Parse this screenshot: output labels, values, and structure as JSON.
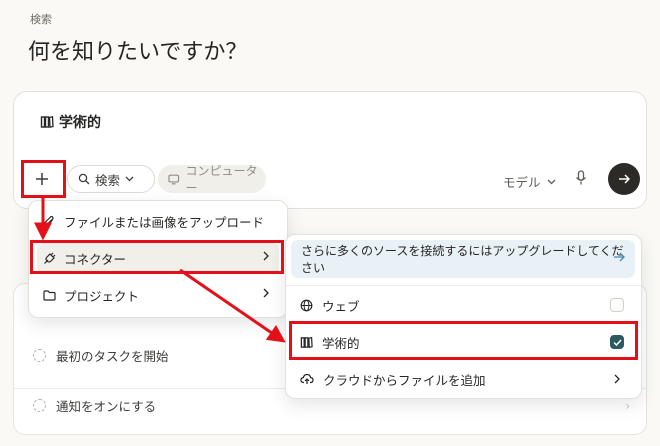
{
  "header": {
    "eyebrow": "検索",
    "title": "何を知りたいですか？"
  },
  "composer": {
    "mode_label": "学術的",
    "search_label": "検索",
    "computer_label": "コンピューター",
    "model_label": "モデル"
  },
  "tasks": [
    {
      "label": "最初のタスクを開始"
    },
    {
      "label": "通知をオンにする"
    }
  ],
  "attach_menu": {
    "items": [
      {
        "label": "ファイルまたは画像をアップロード",
        "icon": "paperclip-icon"
      },
      {
        "label": "コネクター",
        "icon": "plug-icon",
        "has_submenu": true
      },
      {
        "label": "プロジェクト",
        "icon": "folder-icon",
        "has_submenu": true
      }
    ]
  },
  "connector_menu": {
    "upgrade_label": "さらに多くのソースを接続するにはアップグレードしてください",
    "items": [
      {
        "label": "ウェブ",
        "icon": "globe-icon",
        "checked": false
      },
      {
        "label": "学術的",
        "icon": "books-icon",
        "checked": true
      },
      {
        "label": "クラウドからファイルを追加",
        "icon": "cloud-upload-icon",
        "has_submenu": true
      }
    ]
  },
  "colors": {
    "background": "#faf9f5",
    "highlight": "#e3101a",
    "checkbox_on": "#2b5a5f",
    "upgrade_bg": "#e8f1f6",
    "send_bg": "#2b2a27"
  }
}
